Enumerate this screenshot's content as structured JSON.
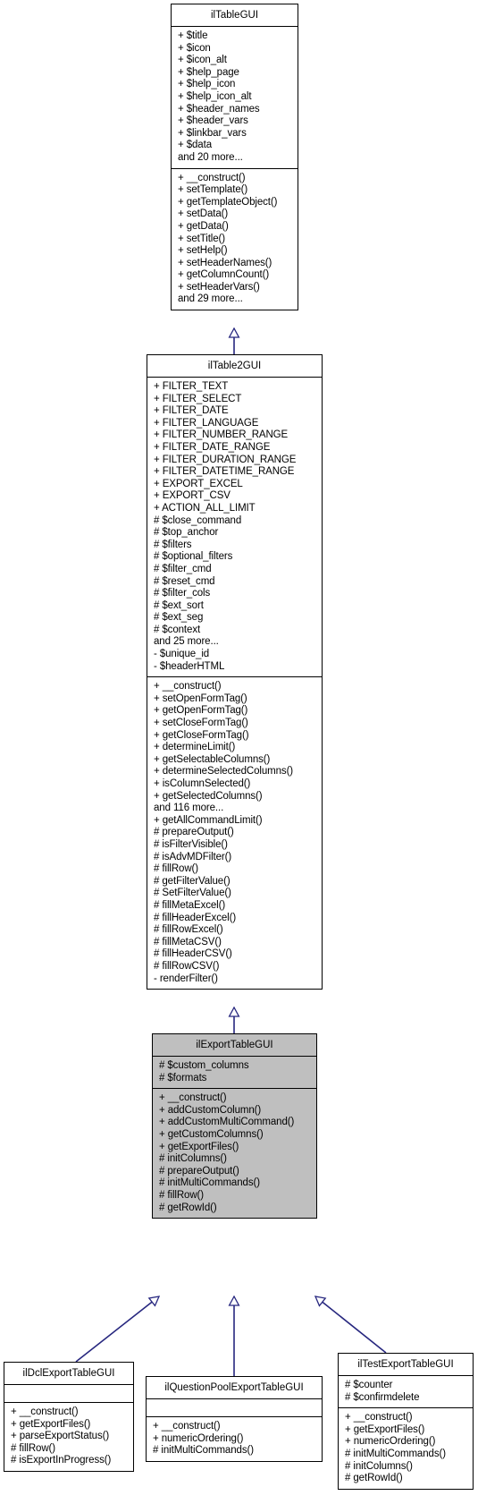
{
  "diagram": {
    "type": "uml-class-inheritance",
    "style": "doxygen-collaboration-graph",
    "edge_color": "#27277f",
    "highlight_color": "#bfbfbf",
    "background": "#ffffff"
  },
  "classes": [
    {
      "id": "ilTableGUI",
      "name": "ilTableGUI",
      "highlighted": false,
      "attributes": [
        "+ $title",
        "+ $icon",
        "+ $icon_alt",
        "+ $help_page",
        "+ $help_icon",
        "+ $help_icon_alt",
        "+ $header_names",
        "+ $header_vars",
        "+ $linkbar_vars",
        "+ $data",
        "and 20 more..."
      ],
      "methods": [
        "+ __construct()",
        "+ setTemplate()",
        "+ getTemplateObject()",
        "+ setData()",
        "+ getData()",
        "+ setTitle()",
        "+ setHelp()",
        "+ setHeaderNames()",
        "+ getColumnCount()",
        "+ setHeaderVars()",
        "and 29 more..."
      ]
    },
    {
      "id": "ilTable2GUI",
      "name": "ilTable2GUI",
      "highlighted": false,
      "attributes": [
        "+ FILTER_TEXT",
        "+ FILTER_SELECT",
        "+ FILTER_DATE",
        "+ FILTER_LANGUAGE",
        "+ FILTER_NUMBER_RANGE",
        "+ FILTER_DATE_RANGE",
        "+ FILTER_DURATION_RANGE",
        "+ FILTER_DATETIME_RANGE",
        "+ EXPORT_EXCEL",
        "+ EXPORT_CSV",
        "+ ACTION_ALL_LIMIT",
        "# $close_command",
        "# $top_anchor",
        "# $filters",
        "# $optional_filters",
        "# $filter_cmd",
        "# $reset_cmd",
        "# $filter_cols",
        "# $ext_sort",
        "# $ext_seg",
        "# $context",
        "and 25 more...",
        "- $unique_id",
        "- $headerHTML"
      ],
      "methods": [
        "+ __construct()",
        "+ setOpenFormTag()",
        "+ getOpenFormTag()",
        "+ setCloseFormTag()",
        "+ getCloseFormTag()",
        "+ determineLimit()",
        "+ getSelectableColumns()",
        "+ determineSelectedColumns()",
        "+ isColumnSelected()",
        "+ getSelectedColumns()",
        "and 116 more...",
        "+ getAllCommandLimit()",
        "# prepareOutput()",
        "# isFilterVisible()",
        "# isAdvMDFilter()",
        "# fillRow()",
        "# getFilterValue()",
        "# SetFilterValue()",
        "# fillMetaExcel()",
        "# fillHeaderExcel()",
        "# fillRowExcel()",
        "# fillMetaCSV()",
        "# fillHeaderCSV()",
        "# fillRowCSV()",
        "- renderFilter()"
      ]
    },
    {
      "id": "ilExportTableGUI",
      "name": "ilExportTableGUI",
      "highlighted": true,
      "attributes": [
        "# $custom_columns",
        "# $formats"
      ],
      "methods": [
        "+ __construct()",
        "+ addCustomColumn()",
        "+ addCustomMultiCommand()",
        "+ getCustomColumns()",
        "+ getExportFiles()",
        "# initColumns()",
        "# prepareOutput()",
        "# initMultiCommands()",
        "# fillRow()",
        "# getRowId()"
      ]
    },
    {
      "id": "ilDclExportTableGUI",
      "name": "ilDclExportTableGUI",
      "highlighted": false,
      "attributes": [],
      "methods": [
        "+ __construct()",
        "+ getExportFiles()",
        "+ parseExportStatus()",
        "# fillRow()",
        "# isExportInProgress()"
      ]
    },
    {
      "id": "ilQuestionPoolExportTableGUI",
      "name": "ilQuestionPoolExportTableGUI",
      "highlighted": false,
      "attributes": [],
      "methods": [
        "+ __construct()",
        "+ numericOrdering()",
        "# initMultiCommands()"
      ]
    },
    {
      "id": "ilTestExportTableGUI",
      "name": "ilTestExportTableGUI",
      "highlighted": false,
      "attributes": [
        "# $counter",
        "# $confirmdelete"
      ],
      "methods": [
        "+ __construct()",
        "+ getExportFiles()",
        "+ numericOrdering()",
        "# initMultiCommands()",
        "# initColumns()",
        "# getRowId()"
      ]
    }
  ],
  "edges": [
    {
      "from": "ilTable2GUI",
      "to": "ilTableGUI",
      "relation": "inheritance"
    },
    {
      "from": "ilExportTableGUI",
      "to": "ilTable2GUI",
      "relation": "inheritance"
    },
    {
      "from": "ilDclExportTableGUI",
      "to": "ilExportTableGUI",
      "relation": "inheritance"
    },
    {
      "from": "ilQuestionPoolExportTableGUI",
      "to": "ilExportTableGUI",
      "relation": "inheritance"
    },
    {
      "from": "ilTestExportTableGUI",
      "to": "ilExportTableGUI",
      "relation": "inheritance"
    }
  ]
}
